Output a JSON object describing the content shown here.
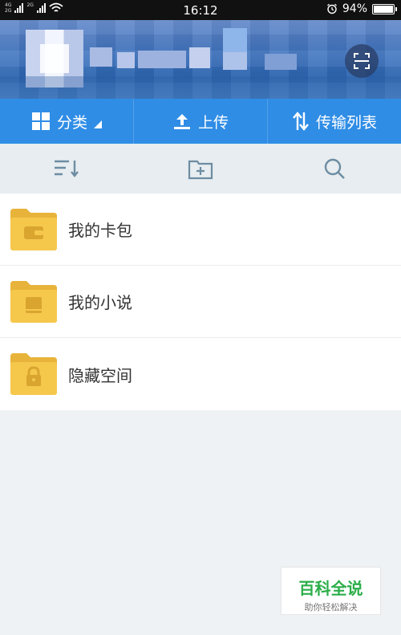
{
  "status_bar": {
    "net_top": "4G",
    "net_bottom": "2G",
    "net_top2": "2G",
    "time": "16:12",
    "battery_percent": "94%",
    "battery_level": 0.94,
    "icons": [
      "signal-icon",
      "wifi-icon",
      "alarm-icon",
      "battery-icon"
    ]
  },
  "header": {
    "avatar_note": "",
    "scan_icon": "scan-icon"
  },
  "toolbar": {
    "items": [
      {
        "label": "分类",
        "icon": "grid-icon"
      },
      {
        "label": "上传",
        "icon": "upload-icon"
      },
      {
        "label": "传输列表",
        "icon": "transfer-icon"
      }
    ]
  },
  "actions": {
    "icons": [
      "sort-icon",
      "new-folder-icon",
      "search-icon"
    ]
  },
  "files": [
    {
      "name": "我的卡包",
      "icon": "wallet-icon"
    },
    {
      "name": "我的小说",
      "icon": "book-icon"
    },
    {
      "name": "隐藏空间",
      "icon": "lock-icon"
    }
  ],
  "watermark": {
    "title": "百科全说",
    "subtitle": "助你轻松解决"
  },
  "colors": {
    "toolbar": "#2f8de6",
    "folder": "#f5c84c",
    "folder_dark": "#e8b33a",
    "watermark": "#2cae4a"
  }
}
